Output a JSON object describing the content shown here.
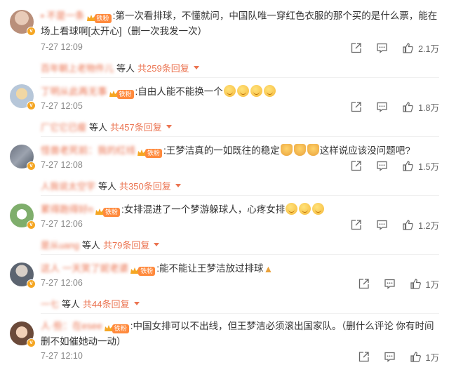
{
  "comments": [
    {
      "username": "▪ 不是一条",
      "fan_tag": "铁粉",
      "text": ":第一次看排球，不懂就问，中国队唯一穿红色衣服的那个买的是什么票，能在场上看球啊[太开心]（删一次我发一次）",
      "time": "7-27 12:09",
      "likes": "2.1万",
      "reply_user": "百年朝上老物件儿",
      "reply_wait": "等人",
      "reply_total": "共259条回复",
      "avatar_color": "#d9b5a0"
    },
    {
      "username": "丁明从此再无事",
      "fan_tag": "铁粉",
      "text": ":自由人能不能换一个",
      "emojis": 4,
      "time": "7-27 12:05",
      "likes": "1.8万",
      "reply_user": "厂它它已瘦",
      "reply_wait": "等人",
      "reply_total": "共457条回复",
      "avatar_color": "#c7d6e6"
    },
    {
      "username": "怪兽老死前：我的红线",
      "fan_tag": "铁粉",
      "text": ":王梦洁真的一如既往的稳定",
      "text_after": "这样说应该没问题吧?",
      "thumbs": 3,
      "time": "7-27 12:08",
      "likes": "1.5万",
      "reply_user": "人我说太空宇",
      "reply_wait": "等人",
      "reply_total": "共350条回复",
      "avatar_color": "#a0a8b8"
    },
    {
      "username": "累得跑得好n",
      "fan_tag": "铁粉",
      "text": ":女排混进了一个梦游躲球人，心疼女排",
      "emojis": 3,
      "time": "7-27 12:06",
      "likes": "1.2万",
      "reply_user": "是从uang",
      "reply_wait": "等人",
      "reply_total": "共79条回复",
      "avatar_color": "#7fae6c"
    },
    {
      "username": "这人 一天笑了妮老婆",
      "fan_tag": "铁粉",
      "text": ":能不能让王梦洁放过排球",
      "time": "7-27 12:06",
      "likes": "1万",
      "reply_user": "一七",
      "reply_wait": "等人",
      "reply_total": "共44条回复",
      "avatar_color": "#8a8f99"
    },
    {
      "username": "人·些：在esee",
      "fan_tag": "铁粉",
      "text": ":中国女排可以不出线，但王梦洁必须滚出国家队。（删什么评论 你有时间删不如催她动一动）",
      "time": "7-27 12:10",
      "likes": "1万",
      "avatar_color": "#c9a58a"
    }
  ]
}
